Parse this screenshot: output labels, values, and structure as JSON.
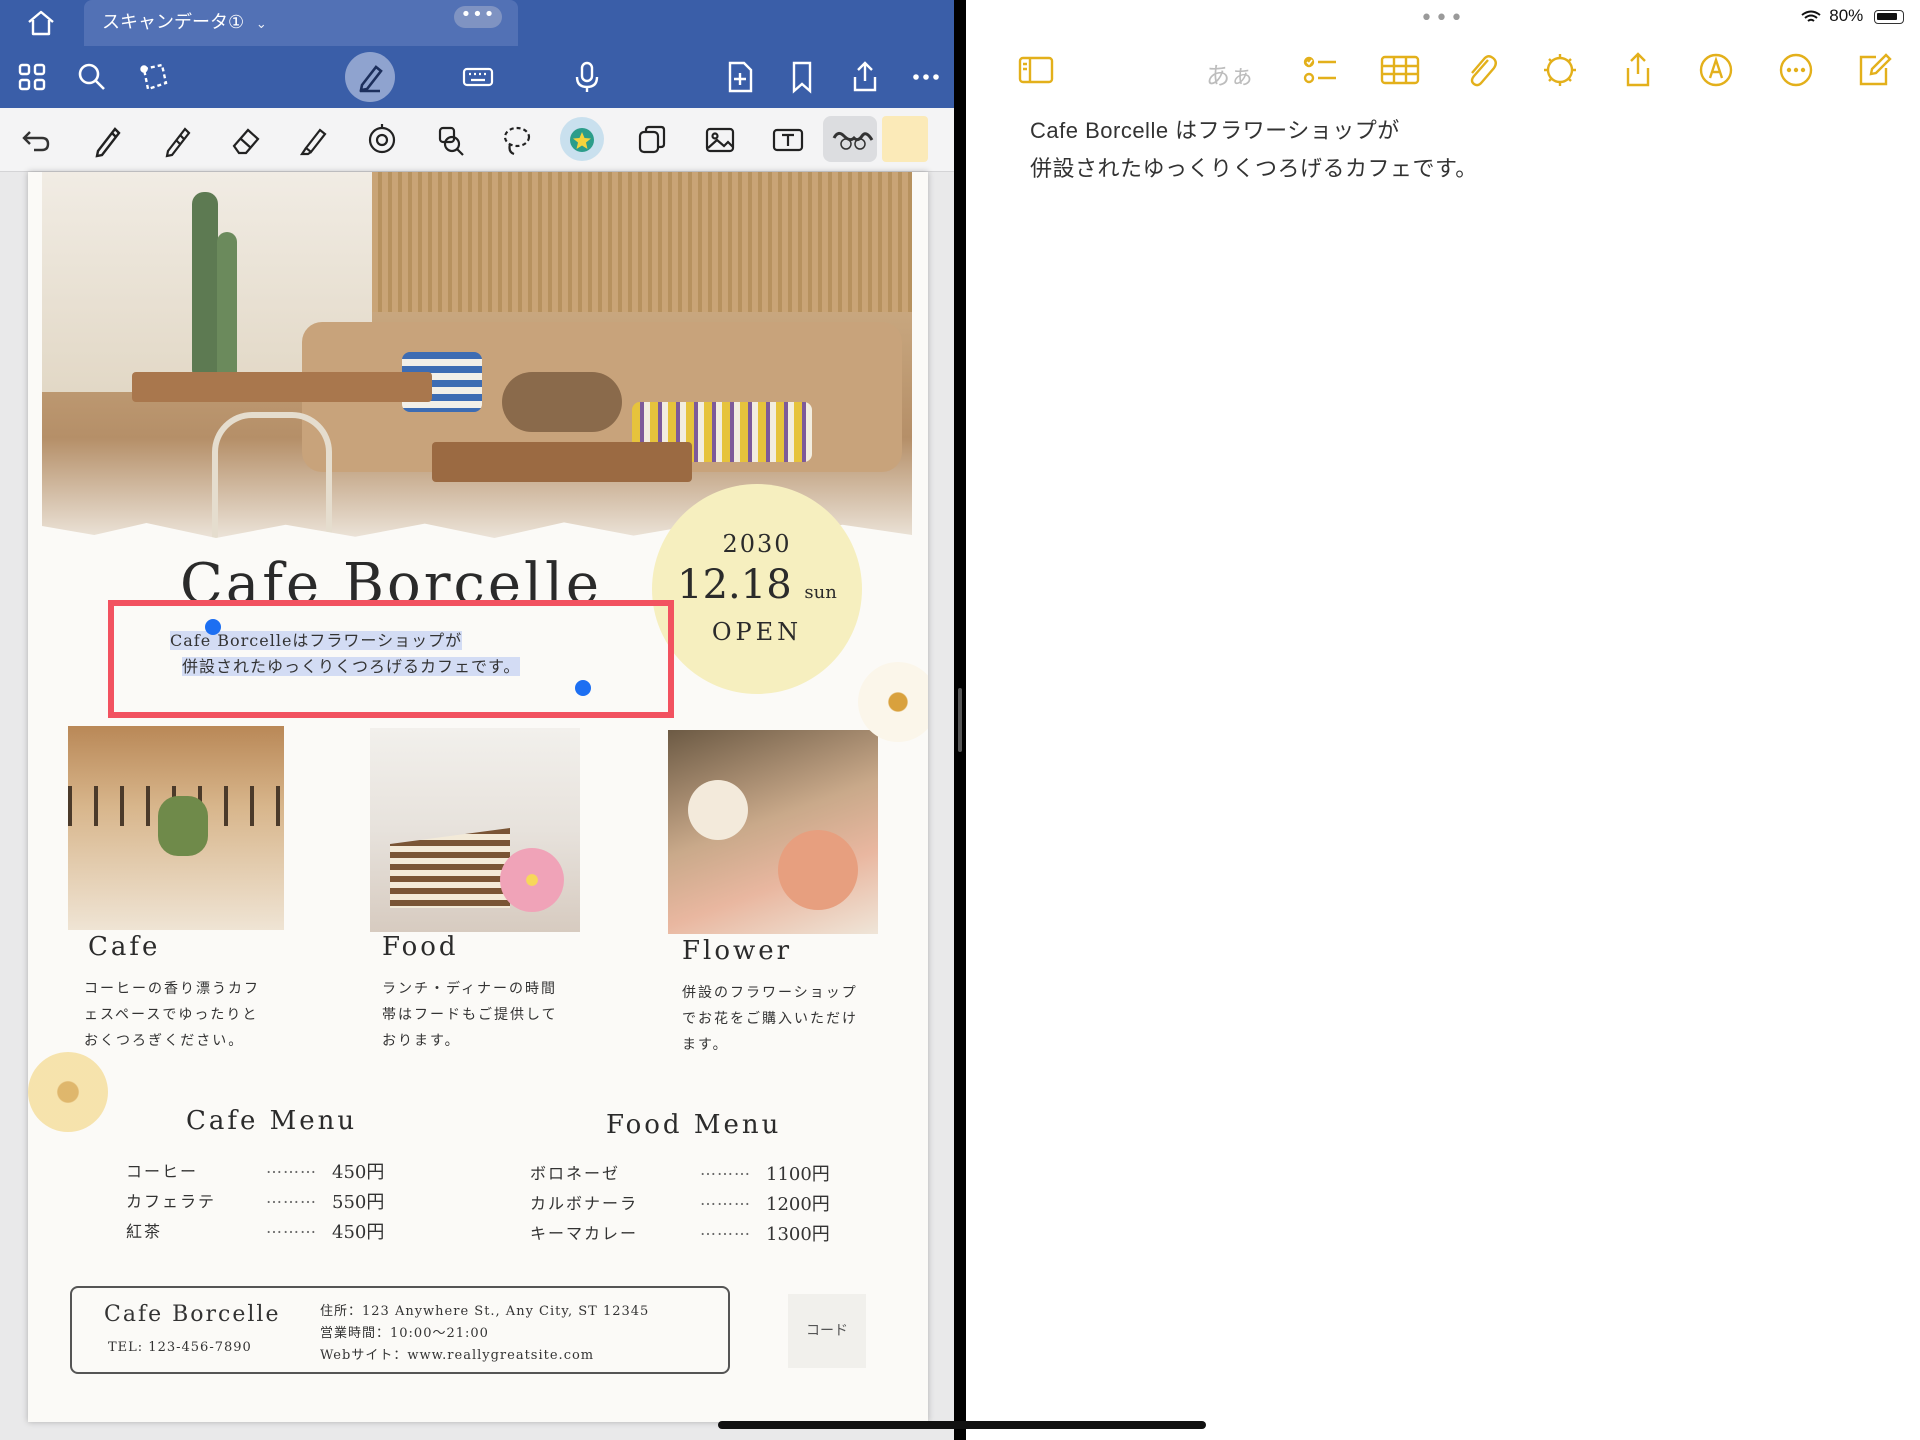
{
  "left_app": {
    "tab": {
      "title": "スキャンデータ①"
    },
    "colors": {
      "header": "#3a5ea8",
      "tab_active": "#5271b5",
      "selection_box": "#f25260",
      "handle": "#1d6ff2",
      "swatch": "#fbeab8"
    },
    "toolbar_icons": [
      "grid-icon",
      "search-icon",
      "lasso-shape-icon",
      "pen-mode-icon",
      "keyboard-icon",
      "microphone-icon",
      "add-page-icon",
      "bookmark-icon",
      "share-icon",
      "more-icon"
    ],
    "tool_icons": [
      "undo-icon",
      "pen-icon",
      "pencil-icon",
      "eraser-icon",
      "highlighter-icon",
      "shape-icon",
      "zoom-icon",
      "lasso-icon",
      "sticker-icon",
      "elements-icon",
      "image-icon",
      "text-tool-icon",
      "stroke-style-icon",
      "color-swatch"
    ]
  },
  "document": {
    "date": {
      "year": "2030",
      "day": "12.18",
      "weekday": "sun",
      "open": "OPEN"
    },
    "title": "Cafe Borcelle",
    "selected_text": {
      "line1": "Cafe Borcelleはフラワーショップが",
      "line2": "併設されたゆっくりくつろげるカフェです。"
    },
    "cards": [
      {
        "title": "Cafe",
        "text": [
          "コーヒーの香り漂うカフ",
          "ェスペースでゆったりと",
          "おくつろぎください。"
        ]
      },
      {
        "title": "Food",
        "text": [
          "ランチ・ディナーの時間",
          "帯はフードもご提供して",
          "おります。"
        ]
      },
      {
        "title": "Flower",
        "text": [
          "併設のフラワーショップ",
          "でお花をご購入いただけ",
          "ます。"
        ]
      }
    ],
    "cafe_menu": {
      "title": "Cafe Menu",
      "items": [
        {
          "name": "コーヒー",
          "dots": "………",
          "price": "450円"
        },
        {
          "name": "カフェラテ",
          "dots": "………",
          "price": "550円"
        },
        {
          "name": "紅茶",
          "dots": "………",
          "price": "450円"
        }
      ]
    },
    "food_menu": {
      "title": "Food Menu",
      "items": [
        {
          "name": "ボロネーゼ",
          "dots": "………",
          "price": "1100円"
        },
        {
          "name": "カルボナーラ",
          "dots": "………",
          "price": "1200円"
        },
        {
          "name": "キーマカレー",
          "dots": "………",
          "price": "1300円"
        }
      ]
    },
    "footer": {
      "name": "Cafe Borcelle",
      "tel": "TEL: 123-456-7890",
      "address": "住所：123 Anywhere St., Any City, ST 12345",
      "hours": "営業時間：10:00～21:00",
      "web": "Webサイト：www.reallygreatsite.com",
      "code_label": "コード"
    }
  },
  "notes_app": {
    "status": {
      "battery": "80%"
    },
    "format_label": "あぁ",
    "accent": "#e3b01b",
    "icons": [
      "sidebar-icon",
      "checklist-icon",
      "table-icon",
      "attachment-icon",
      "magic-icon",
      "share-icon",
      "markup-icon",
      "more-icon",
      "compose-icon"
    ],
    "body": {
      "line1": "Cafe Borcelle はフラワーショップが",
      "line2": "併設されたゆっくりくつろげるカフェです。"
    }
  }
}
